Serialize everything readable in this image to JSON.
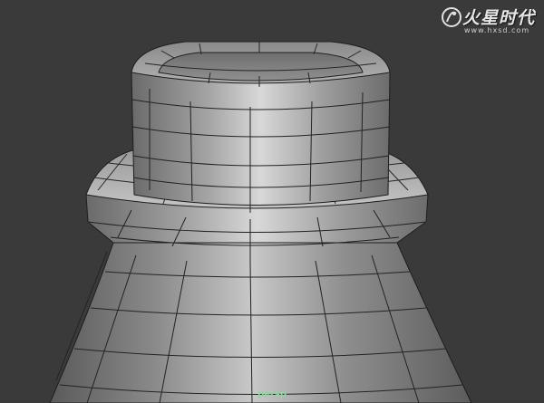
{
  "viewport": {
    "camera_label": "persp",
    "background_color": "#3a3a3a",
    "wire_color": "#1a1a1a",
    "mesh_color": "#8c8c8c"
  },
  "watermark": {
    "brand_text": "火星时代",
    "url_text": "www.hxsd.com",
    "logo_icon": "hxsd-logo-icon"
  }
}
